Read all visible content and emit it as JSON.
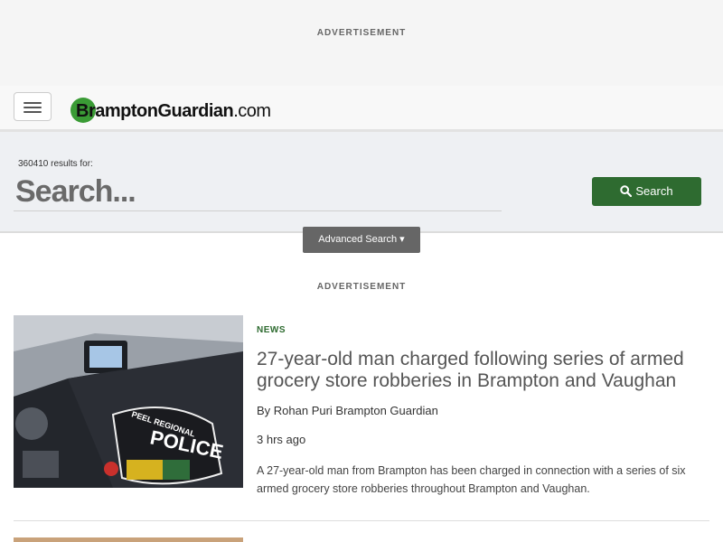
{
  "top_ad": {
    "label": "ADVERTISEMENT"
  },
  "navbar": {
    "logo_main": "BramptonGuardian",
    "logo_domain": ".com"
  },
  "search": {
    "results_count": "360410 results for:",
    "placeholder": "Search...",
    "button_label": "Search",
    "advanced_label": "Advanced Search ▾"
  },
  "mid_ad": {
    "label": "ADVERTISEMENT"
  },
  "articles": [
    {
      "category": "NEWS",
      "headline": "27-year-old man charged following series of armed grocery store robberies in Brampton and Vaughan",
      "byline": "By Rohan Puri Brampton Guardian",
      "timestamp": "3 hrs ago",
      "summary": "A 27-year-old man from Brampton has been charged in connection with a series of six armed grocery store robberies throughout Brampton and Vaughan.",
      "image_text": "PEEL REGIONAL POLICE"
    }
  ],
  "colors": {
    "accent": "#2e6b30",
    "logo_circle": "#3a9b35",
    "advanced_button": "#666666"
  }
}
